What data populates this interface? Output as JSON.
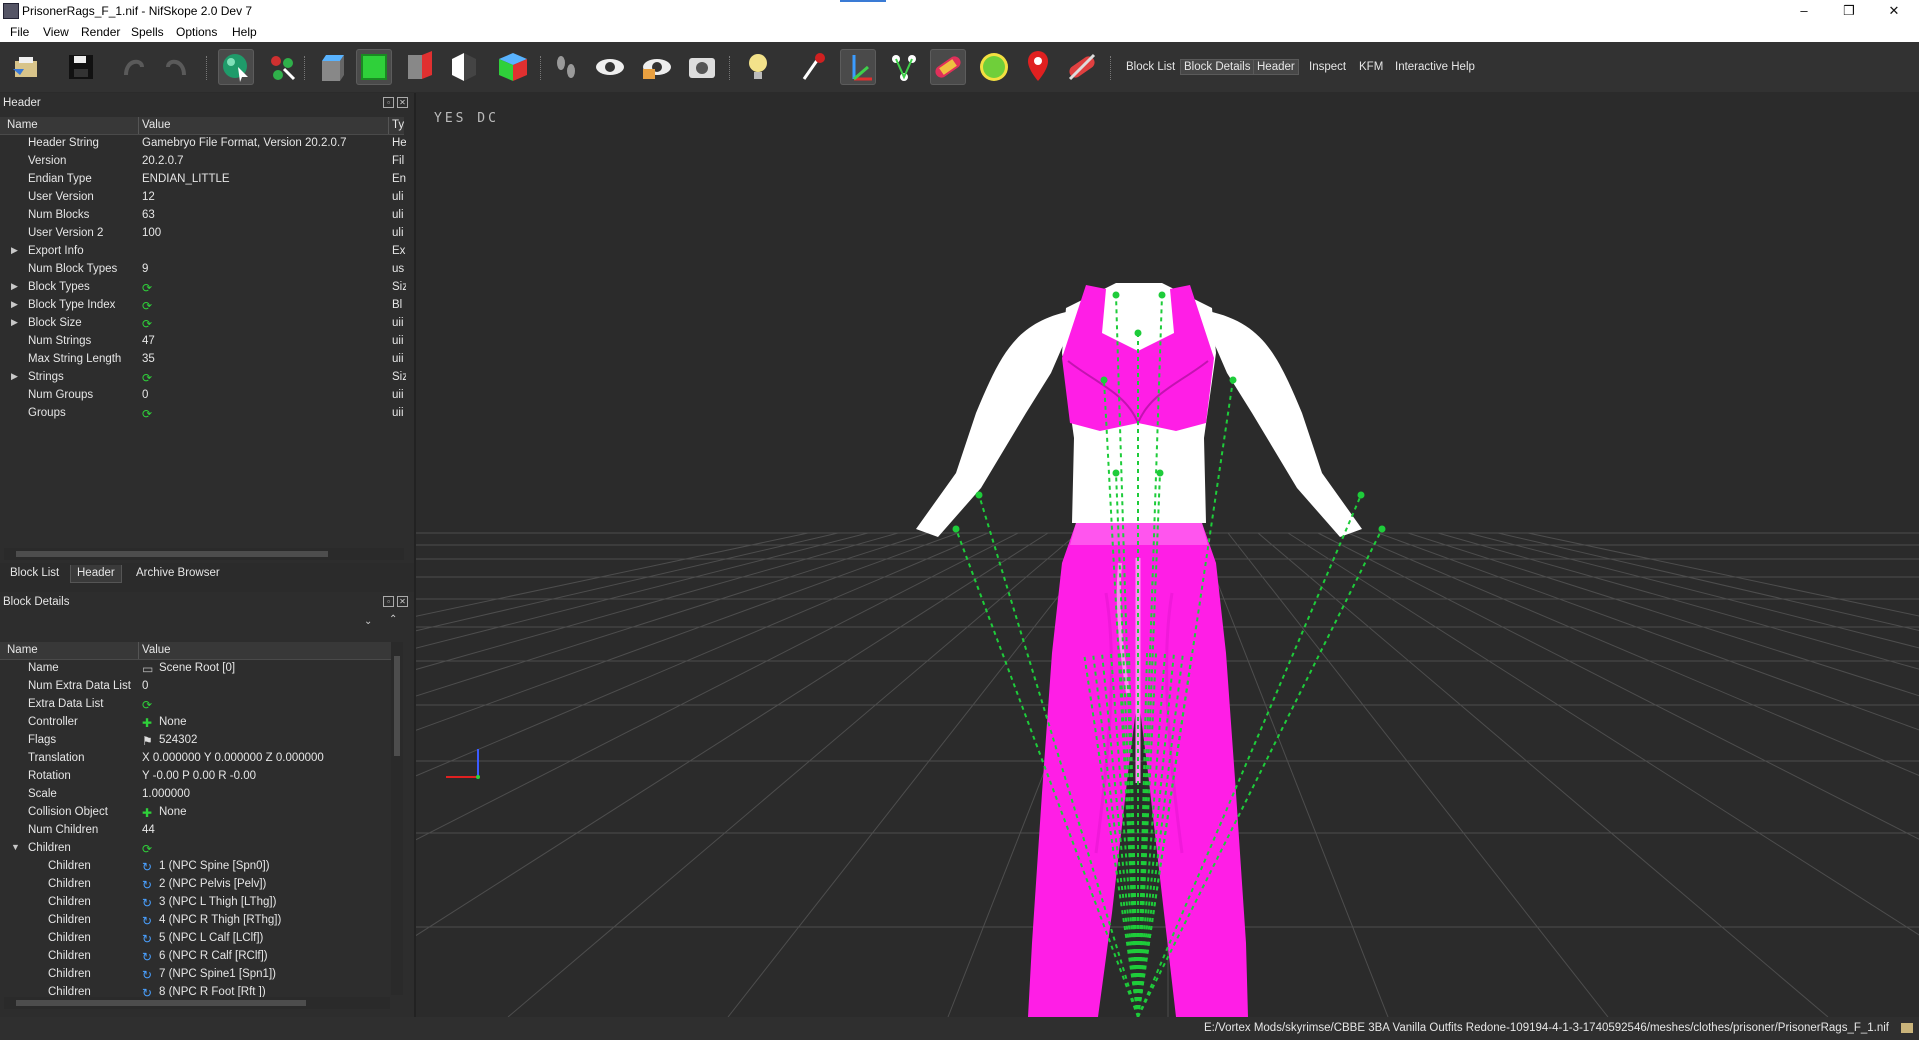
{
  "window": {
    "title": "PrisonerRags_F_1.nif - NifSkope 2.0 Dev 7",
    "controls": [
      "–",
      "❒",
      "✕"
    ]
  },
  "menu": [
    "File",
    "View",
    "Render",
    "Spells",
    "Options",
    "Help"
  ],
  "toolbar": {
    "icons": [
      "load-icon",
      "save-icon",
      "undo-icon",
      "redo-icon",
      "select-object-icon",
      "select-vertex-icon",
      "view-top-icon",
      "view-front-icon",
      "view-side-icon",
      "view-flip-icon",
      "view-perspective-icon",
      "walk-mode-icon",
      "show-hidden-icon",
      "visibility-icon",
      "screenshot-icon",
      "lighting-icon",
      "nodes-icon",
      "axes-icon",
      "constraints-icon",
      "textures-icon",
      "collision-icon",
      "markers-icon",
      "no-collision-icon"
    ],
    "dock_toggles": [
      "Block List",
      "Block Details",
      "Header",
      "Inspect",
      "KFM",
      "Interactive Help"
    ],
    "selected_toggles": [
      "Block Details",
      "Header"
    ]
  },
  "header_dock": {
    "title": "Header",
    "columns": [
      "Name",
      "Value",
      "Ty"
    ],
    "rows": [
      {
        "name": "Header String",
        "value": "Gamebryo File Format, Version 20.2.0.7",
        "type": "He",
        "expandable": false
      },
      {
        "name": "Version",
        "value": "20.2.0.7",
        "type": "Fil",
        "expandable": false
      },
      {
        "name": "Endian Type",
        "value": "ENDIAN_LITTLE",
        "type": "En",
        "expandable": false
      },
      {
        "name": "User Version",
        "value": "12",
        "type": "uli",
        "expandable": false
      },
      {
        "name": "Num Blocks",
        "value": "63",
        "type": "uli",
        "expandable": false
      },
      {
        "name": "User Version 2",
        "value": "100",
        "type": "uli",
        "expandable": false
      },
      {
        "name": "Export Info",
        "value": "",
        "type": "Ex",
        "expandable": true
      },
      {
        "name": "Num Block Types",
        "value": "9",
        "type": "us",
        "expandable": false
      },
      {
        "name": "Block Types",
        "value": "",
        "type": "Siz",
        "expandable": true,
        "link": true
      },
      {
        "name": "Block Type Index",
        "value": "",
        "type": "Bl",
        "expandable": true,
        "link": true
      },
      {
        "name": "Block Size",
        "value": "",
        "type": "uii",
        "expandable": true,
        "link": true
      },
      {
        "name": "Num Strings",
        "value": "47",
        "type": "uii",
        "expandable": false
      },
      {
        "name": "Max String Length",
        "value": "35",
        "type": "uii",
        "expandable": false
      },
      {
        "name": "Strings",
        "value": "",
        "type": "Siz",
        "expandable": true,
        "link": true
      },
      {
        "name": "Num Groups",
        "value": "0",
        "type": "uii",
        "expandable": false
      },
      {
        "name": "Groups",
        "value": "",
        "type": "uii",
        "expandable": false,
        "link": true
      }
    ]
  },
  "dock_tabs": [
    "Block List",
    "Header",
    "Archive Browser"
  ],
  "selected_dock_tab": "Header",
  "details_dock": {
    "title": "Block Details",
    "columns": [
      "Name",
      "Value"
    ],
    "rows": [
      {
        "name": "Name",
        "value": "Scene Root [0]",
        "icon": "string-icon",
        "indent": 0
      },
      {
        "name": "Num Extra Data List",
        "value": "0",
        "icon": "",
        "indent": 0
      },
      {
        "name": "Extra Data List",
        "value": "",
        "icon": "link-icon",
        "indent": 0
      },
      {
        "name": "Controller",
        "value": "None",
        "icon": "plus-icon",
        "indent": 0
      },
      {
        "name": "Flags",
        "value": "524302",
        "icon": "flag-icon",
        "indent": 0
      },
      {
        "name": "Translation",
        "value": "X 0.000000 Y 0.000000 Z 0.000000",
        "icon": "",
        "indent": 0
      },
      {
        "name": "Rotation",
        "value": "Y -0.00 P 0.00 R -0.00",
        "icon": "",
        "indent": 0
      },
      {
        "name": "Scale",
        "value": "1.000000",
        "icon": "",
        "indent": 0
      },
      {
        "name": "Collision Object",
        "value": "None",
        "icon": "plus-icon",
        "indent": 0
      },
      {
        "name": "Num Children",
        "value": "44",
        "icon": "",
        "indent": 0
      },
      {
        "name": "Children",
        "value": "",
        "icon": "link-icon",
        "indent": 0,
        "expanded": true
      },
      {
        "name": "Children",
        "value": "1 (NPC Spine [Spn0])",
        "icon": "child-link-icon",
        "indent": 1
      },
      {
        "name": "Children",
        "value": "2 (NPC Pelvis [Pelv])",
        "icon": "child-link-icon",
        "indent": 1
      },
      {
        "name": "Children",
        "value": "3 (NPC L Thigh [LThg])",
        "icon": "child-link-icon",
        "indent": 1
      },
      {
        "name": "Children",
        "value": "4 (NPC R Thigh [RThg])",
        "icon": "child-link-icon",
        "indent": 1
      },
      {
        "name": "Children",
        "value": "5 (NPC L Calf [LClf])",
        "icon": "child-link-icon",
        "indent": 1
      },
      {
        "name": "Children",
        "value": "6 (NPC R Calf [RClf])",
        "icon": "child-link-icon",
        "indent": 1
      },
      {
        "name": "Children",
        "value": "7 (NPC Spine1 [Spn1])",
        "icon": "child-link-icon",
        "indent": 1
      },
      {
        "name": "Children",
        "value": "8 (NPC R Foot [Rft ])",
        "icon": "child-link-icon",
        "indent": 1
      }
    ]
  },
  "viewport": {
    "label": "YES DC",
    "mesh_color": "#ff1ee6",
    "skin_color": "#ffffff",
    "bone_color": "#1ecc3a"
  },
  "status": {
    "path": "E:/Vortex Mods/skyrimse/CBBE 3BA Vanilla Outfits Redone-109194-4-1-3-1740592546/meshes/clothes/prisoner/PrisonerRags_F_1.nif"
  }
}
